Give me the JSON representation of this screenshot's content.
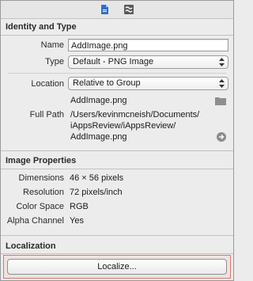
{
  "tabs": [
    {
      "icon": "file-inspector-icon"
    },
    {
      "icon": "quick-help-icon"
    }
  ],
  "identity": {
    "heading": "Identity and Type",
    "name_label": "Name",
    "name_value": "AddImage.png",
    "type_label": "Type",
    "type_value": "Default - PNG Image",
    "location_label": "Location",
    "location_value": "Relative to Group",
    "location_file": "AddImage.png",
    "fullpath_label": "Full Path",
    "fullpath_line1": "/Users/kevinmcneish/Documents/",
    "fullpath_line2": "iAppsReview/iAppsReview/",
    "fullpath_line3": "AddImage.png"
  },
  "image_properties": {
    "heading": "Image Properties",
    "rows": [
      {
        "label": "Dimensions",
        "value": "46 × 56 pixels"
      },
      {
        "label": "Resolution",
        "value": "72 pixels/inch"
      },
      {
        "label": "Color Space",
        "value": "RGB"
      },
      {
        "label": "Alpha Channel",
        "value": "Yes"
      }
    ]
  },
  "localization": {
    "heading": "Localization",
    "button_label": "Localize..."
  },
  "colors": {
    "highlight_border": "#d47a6e",
    "panel_bg": "#ececec"
  }
}
